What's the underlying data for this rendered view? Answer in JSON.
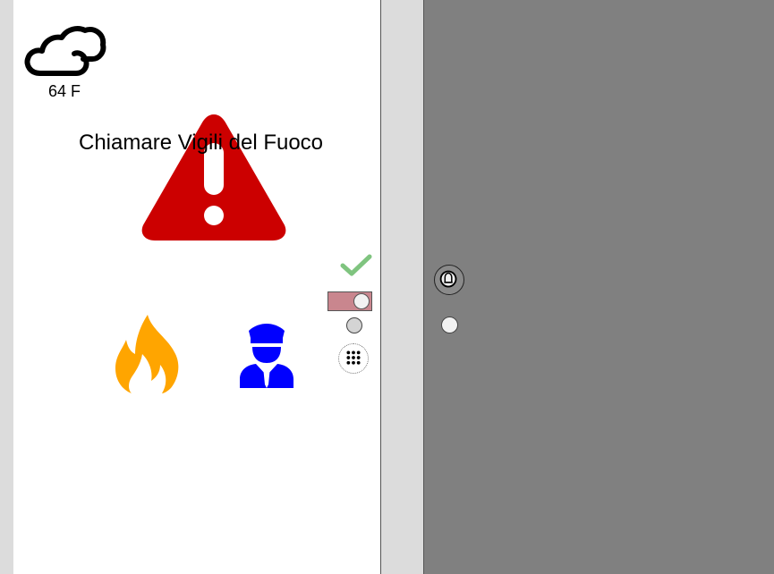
{
  "weather": {
    "icon": "cloud-icon",
    "temperature": "64 F"
  },
  "alert": {
    "icon": "warning-icon",
    "text": "Chiamare Vigili del Fuoco",
    "color": "#cc0000"
  },
  "services": {
    "fire_icon": "fire-icon",
    "fire_color": "#ffa500",
    "police_icon": "police-officer-icon",
    "police_color": "#0000ff"
  },
  "controls": {
    "check_icon": "checkmark-icon",
    "check_color": "#7fc47f",
    "toggle_on": true,
    "toggle_color": "#c9868e",
    "dialpad_icon": "dialpad-icon"
  },
  "door": {
    "doorbell_icon": "doorbell-icon",
    "background": "#808080"
  }
}
